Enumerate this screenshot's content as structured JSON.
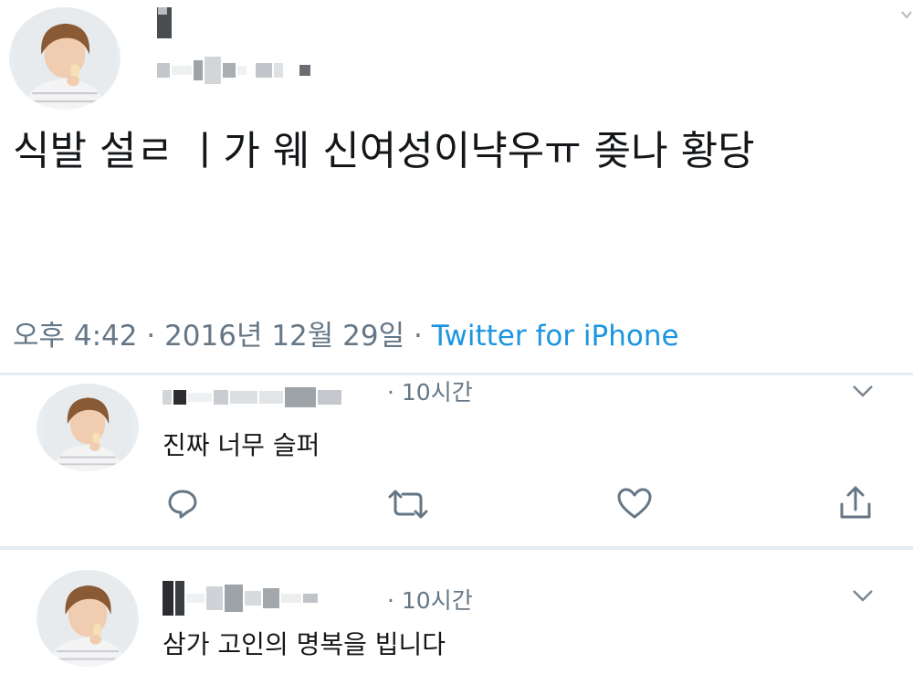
{
  "main_tweet": {
    "text": "식발 설ㄹ ㅣ가 웨 신여성이냑우ㅠ 좆나 황당",
    "timestamp": "오후 4:42 · 2016년 12월 29일 · ",
    "source": "Twitter for iPhone"
  },
  "replies": [
    {
      "time": "· 10시간",
      "text": "진짜 너무 슬퍼",
      "actions": [
        "reply-icon",
        "retweet-icon",
        "like-icon",
        "share-icon"
      ]
    },
    {
      "time": "· 10시간",
      "text": "삼가 고인의 명복을 빕니다"
    }
  ],
  "colors": {
    "text": "#14171a",
    "muted": "#657786",
    "link": "#1b95e0",
    "divider": "#e6ecf0"
  }
}
